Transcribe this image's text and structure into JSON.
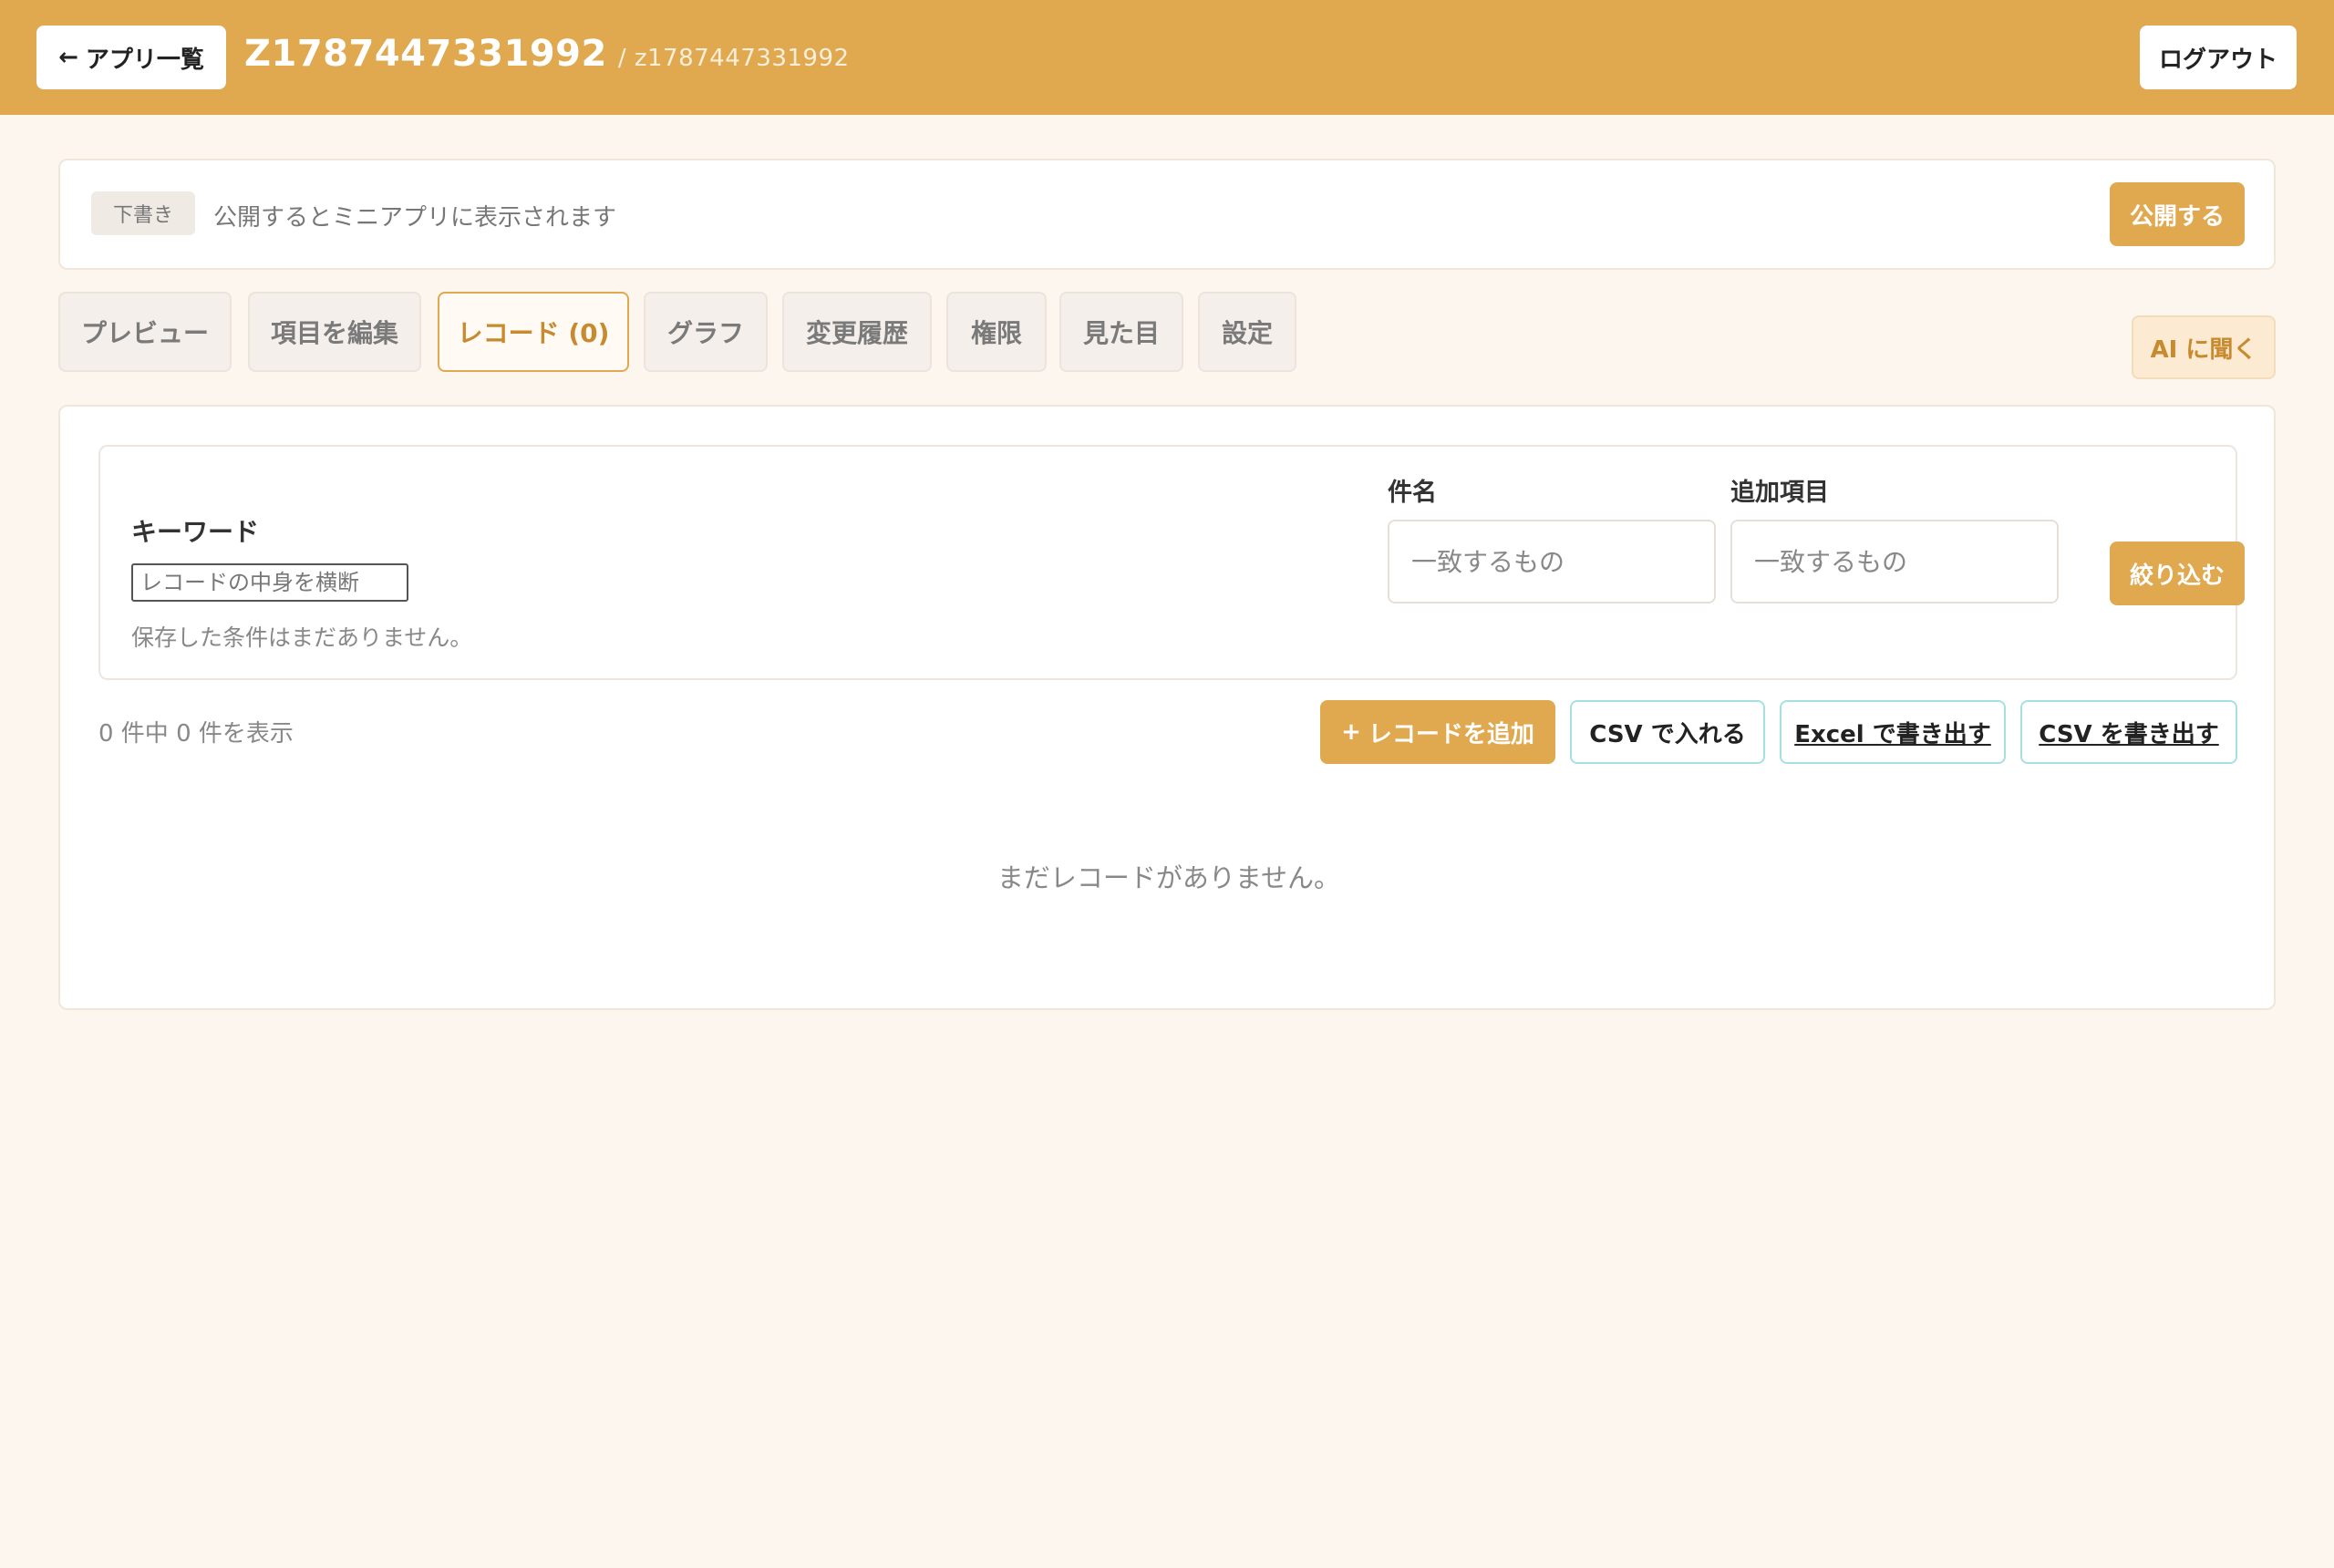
{
  "header": {
    "back_label": "アプリ一覧",
    "back_icon": "←",
    "app_name": "Z1787447331992",
    "app_slug": "/ z1787447331992",
    "logout_label": "ログアウト"
  },
  "status": {
    "badge": "下書き",
    "message": "公開するとミニアプリに表示されます",
    "publish_label": "公開する"
  },
  "tabs": [
    {
      "label": "プレビュー",
      "active": false
    },
    {
      "label": "項目を編集",
      "active": false
    },
    {
      "label": "レコード (0)",
      "active": true
    },
    {
      "label": "グラフ",
      "active": false
    },
    {
      "label": "変更履歴",
      "active": false
    },
    {
      "label": "権限",
      "active": false
    },
    {
      "label": "見た目",
      "active": false
    },
    {
      "label": "設定",
      "active": false
    }
  ],
  "ai_button": "AI に聞く",
  "filter": {
    "keyword_label": "キーワード",
    "keyword_placeholder": "レコードの中身を横断",
    "saved_message": "保存した条件はまだありません。",
    "fields": [
      {
        "label": "件名",
        "placeholder": "一致するもの"
      },
      {
        "label": "追加項目",
        "placeholder": "一致するもの"
      }
    ],
    "apply_label": "絞り込む"
  },
  "records": {
    "count_text": "0 件中 0 件を表示",
    "add_label": "レコードを追加",
    "add_icon": "+",
    "csv_import_label": "CSV で入れる",
    "excel_export_label": "Excel で書き出す",
    "csv_export_label": "CSV を書き出す",
    "empty_message": "まだレコードがありません。"
  },
  "colors": {
    "accent": "#e0a94f",
    "background": "#fdf6ef",
    "outline_teal": "#a8dfe0"
  }
}
